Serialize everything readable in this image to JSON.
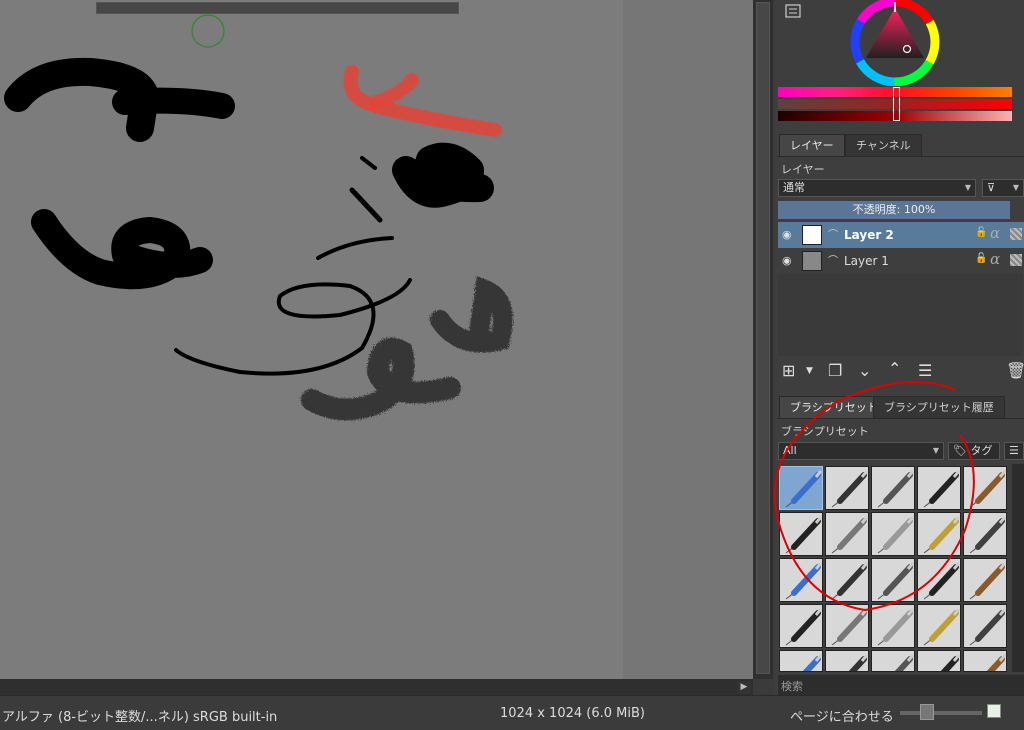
{
  "layers_tabs": [
    "レイヤー",
    "チャンネル"
  ],
  "layers_panel": {
    "title": "レイヤー",
    "blend_mode": "通常",
    "opacity_label": "不透明度:  100%",
    "layers": [
      {
        "name": "Layer 2",
        "selected": true
      },
      {
        "name": "Layer 1",
        "selected": false
      }
    ]
  },
  "brush_tabs": [
    "ブラシプリセット",
    "ブラシプリセット履歴"
  ],
  "brush_panel": {
    "title": "ブラシプリセット",
    "filter": "All",
    "tag_label": "タグ",
    "search_placeholder": "検索"
  },
  "statusbar": {
    "color_info": "アルファ (8-ビット整数/...ネル)  sRGB built-in",
    "image_size": "1024 x 1024 (6.0 MiB)",
    "zoom_label": "ページに合わせる"
  },
  "colors": {
    "canvas": "#7c7c7c",
    "stroke": "#000000",
    "red_stroke": "#e0463c",
    "selection": "#587b9c",
    "annotation": "#e00000"
  },
  "icons": [
    "eye-icon",
    "add-layer-icon",
    "duplicate-icon",
    "move-down-icon",
    "move-up-icon",
    "properties-icon",
    "trash-icon",
    "filter-icon",
    "tag-icon",
    "color-triangle-icon"
  ]
}
